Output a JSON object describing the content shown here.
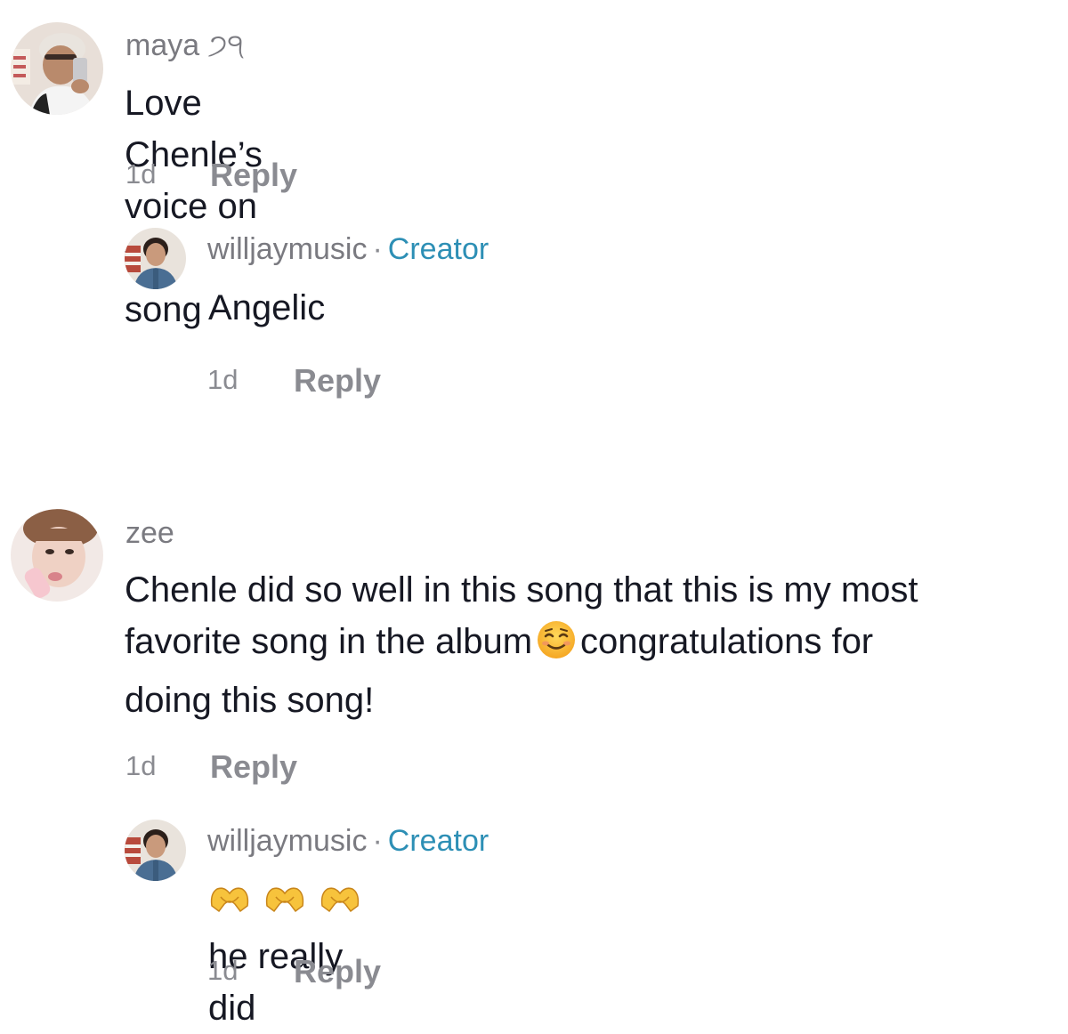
{
  "comments": [
    {
      "username": "maya ੭੧",
      "text": "Love Chenle’s voice on this song",
      "time": "1d",
      "reply_label": "Reply",
      "reply": {
        "username": "willjaymusic",
        "separator": "·",
        "creator_label": "Creator",
        "text": "Angelic",
        "time": "1d",
        "reply_label": "Reply"
      }
    },
    {
      "username": "zee",
      "text_line1": "Chenle did so well in this song that this is my most",
      "text_line2a": "favorite song in the album",
      "text_line2b": "congratulations for",
      "text_line3": "doing this song!",
      "emoji": "smiling-face-emoji",
      "time": "1d",
      "reply_label": "Reply",
      "reply": {
        "username": "willjaymusic",
        "separator": "·",
        "creator_label": "Creator",
        "emoji": "heart-hands-emoji",
        "text": "he really did",
        "time": "1d",
        "reply_label": "Reply"
      }
    }
  ],
  "colors": {
    "creator": "#2d8fb5",
    "muted": "#8a8b91",
    "text": "#161823"
  }
}
